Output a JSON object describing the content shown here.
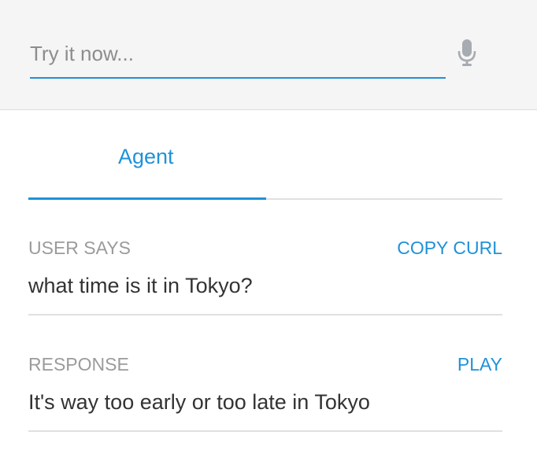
{
  "input": {
    "placeholder": "Try it now...",
    "value": ""
  },
  "icons": {
    "mic": "microphone-icon"
  },
  "colors": {
    "accent": "#1f92d8",
    "top_background": "#f5f5f5",
    "muted_text": "#9b9b9b",
    "body_text": "#333333"
  },
  "tabs": [
    {
      "label": "Agent",
      "active": true
    }
  ],
  "user_says": {
    "label": "USER SAYS",
    "action": "COPY CURL",
    "text": "what time is it in Tokyo?"
  },
  "response": {
    "label": "RESPONSE",
    "action": "PLAY",
    "text": "It's way too early or too late in Tokyo"
  }
}
